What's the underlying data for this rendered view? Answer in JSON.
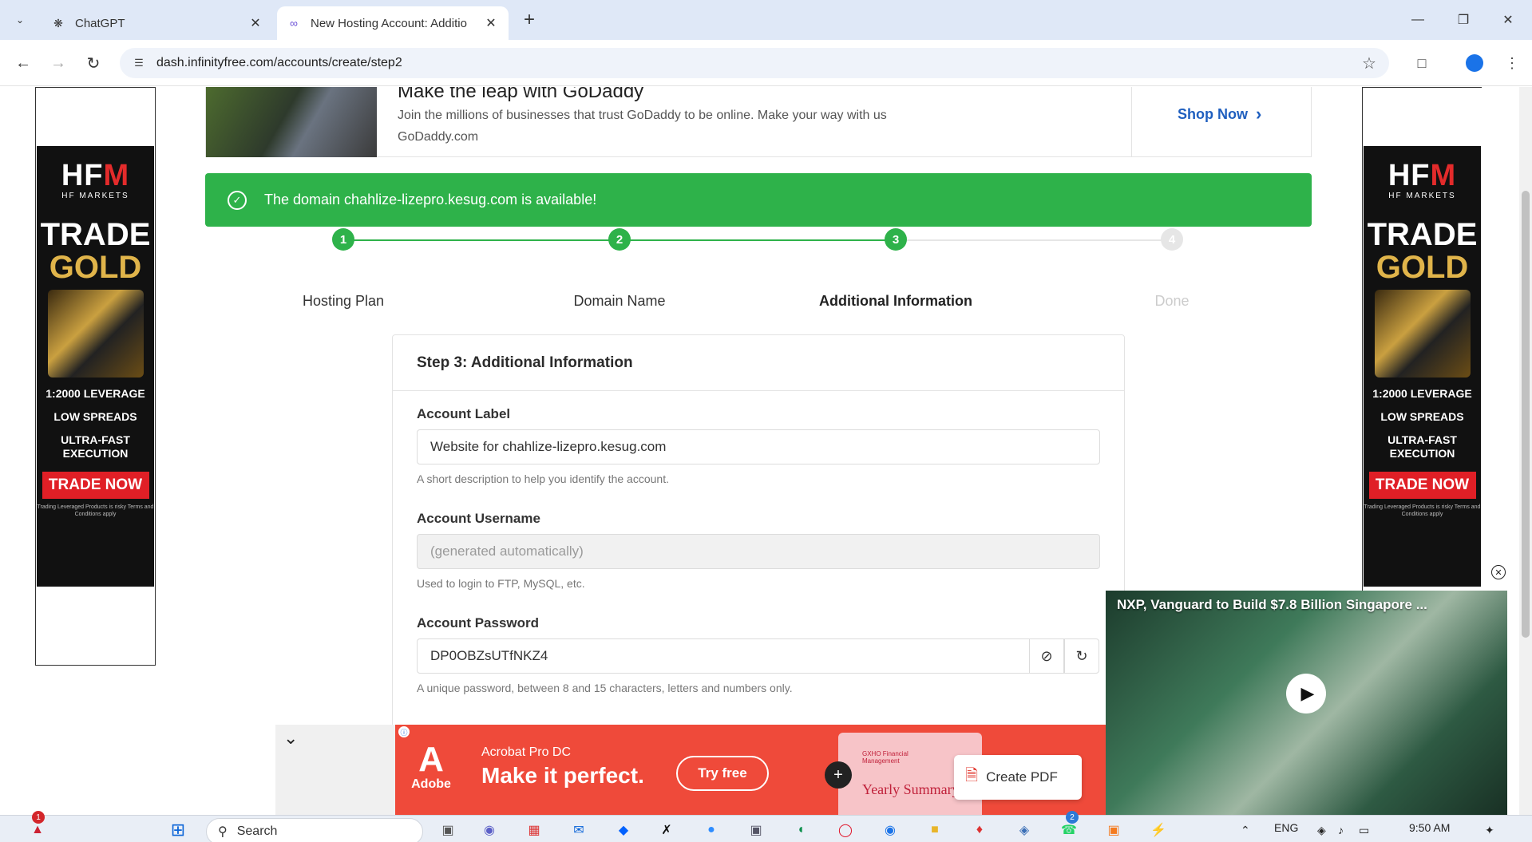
{
  "browser": {
    "tabs": [
      {
        "title": "ChatGPT",
        "active": false
      },
      {
        "title": "New Hosting Account: Additio",
        "active": true
      }
    ],
    "url": "dash.infinityfree.com/accounts/create/step2"
  },
  "banner_ad": {
    "headline": "Make the leap with GoDaddy",
    "text": "Join the millions of businesses that trust GoDaddy to be online. Make your way with us GoDaddy.com",
    "cta": "Shop Now"
  },
  "side_ad": {
    "brand": "HFM",
    "brand_sub": "HF MARKETS",
    "line1": "TRADE",
    "line2": "GOLD",
    "feature1": "1:2000 LEVERAGE",
    "feature2": "LOW SPREADS",
    "feature3": "ULTRA-FAST EXECUTION",
    "cta": "TRADE NOW",
    "fine_print": "Trading Leveraged Products is risky Terms and Conditions apply"
  },
  "alert": {
    "text": "The domain chahlize-lizepro.kesug.com is available!"
  },
  "stepper": {
    "steps": [
      {
        "number": "1",
        "label": "Hosting Plan",
        "state": "done"
      },
      {
        "number": "2",
        "label": "Domain Name",
        "state": "done"
      },
      {
        "number": "3",
        "label": "Additional Information",
        "state": "current"
      },
      {
        "number": "4",
        "label": "Done",
        "state": "todo"
      }
    ]
  },
  "form": {
    "title": "Step 3: Additional Information",
    "account_label": {
      "label": "Account Label",
      "value": "Website for chahlize-lizepro.kesug.com",
      "help": "A short description to help you identify the account."
    },
    "account_username": {
      "label": "Account Username",
      "placeholder": "(generated automatically)",
      "help": "Used to login to FTP, MySQL, etc."
    },
    "account_password": {
      "label": "Account Password",
      "value": "DP0OBZsUTfNKZ4",
      "help": "A unique password, between 8 and 15 characters, letters and numbers only."
    }
  },
  "bottom_ad": {
    "brand": "Adobe",
    "product": "Acrobat Pro DC",
    "tagline": "Make it perfect.",
    "cta": "Try free",
    "doc_title": "Yearly Summary",
    "doc_org": "GXHO Financial Management",
    "action": "Create PDF"
  },
  "video": {
    "title": "NXP, Vanguard to Build $7.8 Billion Singapore ..."
  },
  "taskbar": {
    "search_placeholder": "Search",
    "notification_count": "1",
    "whatsapp_count": "2",
    "language": "ENG",
    "time": "9:50 AM"
  },
  "colors": {
    "success": "#2eb24a",
    "link": "#1f5fbf",
    "acrobat": "#ef4a3a",
    "hfm_red": "#e01f26"
  }
}
